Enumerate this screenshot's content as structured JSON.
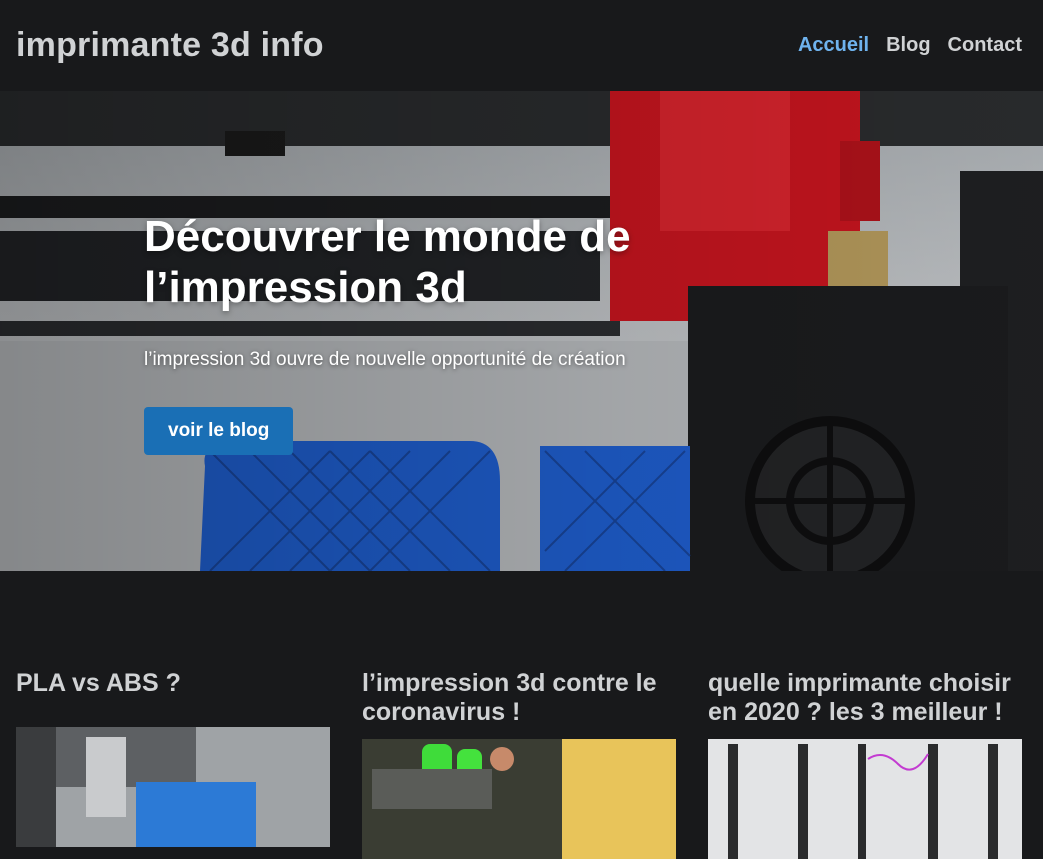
{
  "header": {
    "site_title": "imprimante 3d info",
    "nav": [
      {
        "label": "Accueil",
        "active": true
      },
      {
        "label": "Blog",
        "active": false
      },
      {
        "label": "Contact",
        "active": false
      }
    ]
  },
  "hero": {
    "title": "Découvrer le monde de l’impression 3d",
    "subtitle": "l’impression 3d ouvre de nouvelle opportunité de création",
    "button_label": "voir le blog"
  },
  "posts": [
    {
      "title": "PLA vs ABS ?"
    },
    {
      "title": "l’impression 3d contre le coronavirus !"
    },
    {
      "title": "quelle imprimante choisir en 2020 ? les 3 meilleur !"
    }
  ],
  "colors": {
    "background": "#18191b",
    "accent": "#6fb3ee",
    "button": "#1a6fb5"
  }
}
